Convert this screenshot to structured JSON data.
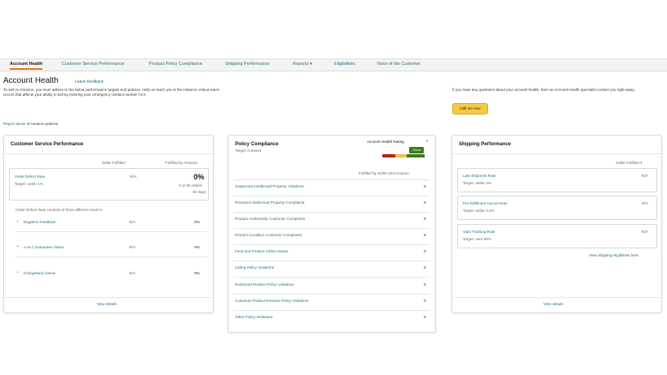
{
  "nav": {
    "tabs": [
      {
        "label": "Account Health"
      },
      {
        "label": "Customer Service Performance"
      },
      {
        "label": "Product Policy Compliance"
      },
      {
        "label": "Shipping Performance"
      },
      {
        "label": "Reports"
      },
      {
        "label": "Eligibilities"
      },
      {
        "label": "Voice of the Customer"
      }
    ]
  },
  "header": {
    "title": "Account Health",
    "feedback": "Leave feedback",
    "intro": "To sell on Amazon, you must adhere to the below performance targets and policies. Help us reach you in the instance critical event occurs that affects your ability to sell by entering your emergency contact number",
    "intro_link": "here.",
    "help_text": "If you have any questions about your account health, here an Account Health specialist contact you right away.",
    "help_button": "Call me now",
    "report_link": "Report abuse",
    "report_suffix": "of Amazon policies"
  },
  "csp": {
    "title": "Customer Service Performance",
    "col_seller": "Seller Fulfilled",
    "col_amazon": "Fulfilled by Amazon",
    "odr_label": "Order Defect Rate",
    "odr_target": "Target: under 1%",
    "odr_seller": "N/A",
    "odr_amazon": "0%",
    "odr_orders": "0 of 35 orders",
    "odr_days": "60 days",
    "metrics_note": "Order Defect Rate consists of three different metrics:",
    "metrics": [
      {
        "label": "Negative Feedback",
        "seller": "N/A",
        "amazon": "0%"
      },
      {
        "label": "A-to-z Guarantee claims",
        "seller": "N/A",
        "amazon": "0%"
      },
      {
        "label": "Chargeback claims",
        "seller": "N/A",
        "amazon": "0%"
      }
    ],
    "view": "View details"
  },
  "policy": {
    "title": "Policy Compliance",
    "target": "Target: 0 issues",
    "rating_label": "Account Health Rating",
    "rating_badge": "Great",
    "col": "Fulfilled by Seller and Amazon",
    "items": [
      {
        "label": "Suspected Intellectual Property Violations",
        "count": "0"
      },
      {
        "label": "Received Intellectual Property Complaints",
        "count": "0"
      },
      {
        "label": "Product Authenticity Customer Complaints",
        "count": "0"
      },
      {
        "label": "Product Condition Customer Complaints",
        "count": "0"
      },
      {
        "label": "Food and Product Safety Issues",
        "count": "0"
      },
      {
        "label": "Listing Policy Violations",
        "count": "0"
      },
      {
        "label": "Restricted Product Policy Violations",
        "count": "0"
      },
      {
        "label": "Customer Product Reviews Policy Violations",
        "count": "0"
      },
      {
        "label": "Other Policy Violations",
        "count": "0"
      }
    ]
  },
  "shipping": {
    "title": "Shipping Performance",
    "col": "Seller Fulfilled",
    "items": [
      {
        "label": "Late Shipment Rate",
        "target": "Target: under 4%",
        "value": "N/A"
      },
      {
        "label": "Pre-fulfillment Cancel Rate",
        "target": "Target: under 2.5%",
        "value": "N/A"
      },
      {
        "label": "Valid Tracking Rate",
        "target": "Target: over 95%",
        "value": "N/A"
      }
    ],
    "eligibility": "View shipping eligibilities here",
    "view": "View details"
  },
  "colors": {
    "accent": "#e47911",
    "link": "#2a6b82",
    "button": "#f7ca45",
    "good": "#3d7a1e",
    "bad": "#b12704"
  }
}
